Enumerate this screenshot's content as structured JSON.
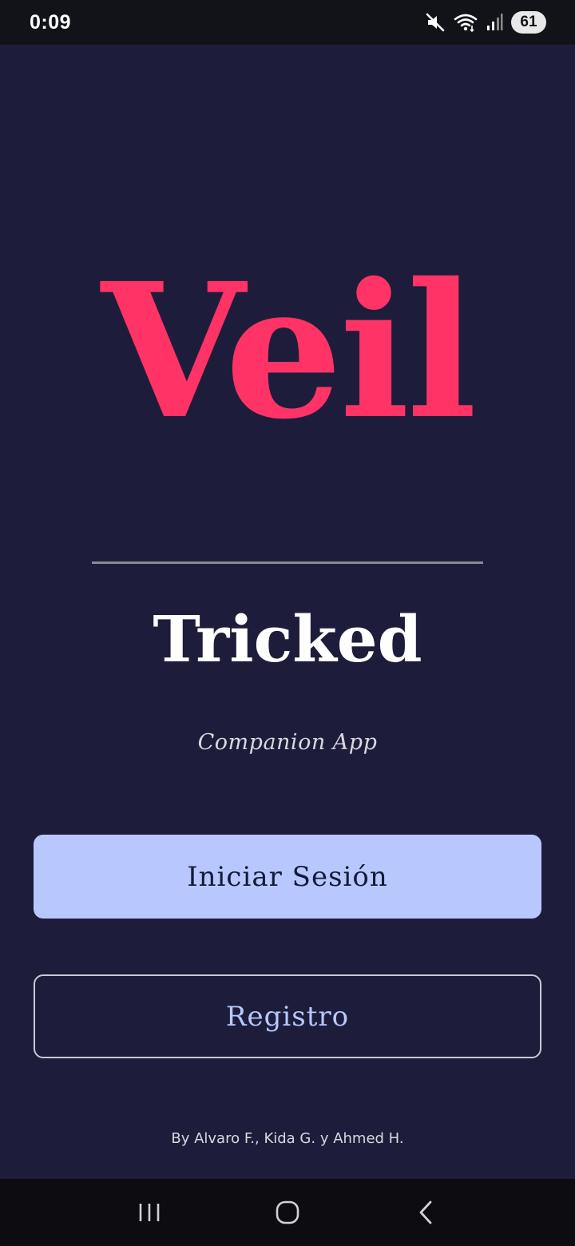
{
  "status_bar": {
    "time": "0:09",
    "battery": "61",
    "icons": [
      "mute-icon",
      "wifi-icon",
      "signal-icon",
      "battery-icon"
    ]
  },
  "app": {
    "logo_text": "Veil",
    "title": "Tricked",
    "subtitle": "Companion App"
  },
  "actions": {
    "login_label": "Iniciar Sesión",
    "register_label": "Registro"
  },
  "footer": {
    "credits": "By Alvaro F., Kida G. y Ahmed H."
  },
  "nav": {
    "icons": [
      "recent-apps-icon",
      "home-icon",
      "back-icon"
    ]
  },
  "colors": {
    "background": "#1d1d3b",
    "logo": "#ff3366",
    "primary_button": "#b8c8ff",
    "status_bar": "#111318",
    "nav_bar": "#0d0d11"
  }
}
